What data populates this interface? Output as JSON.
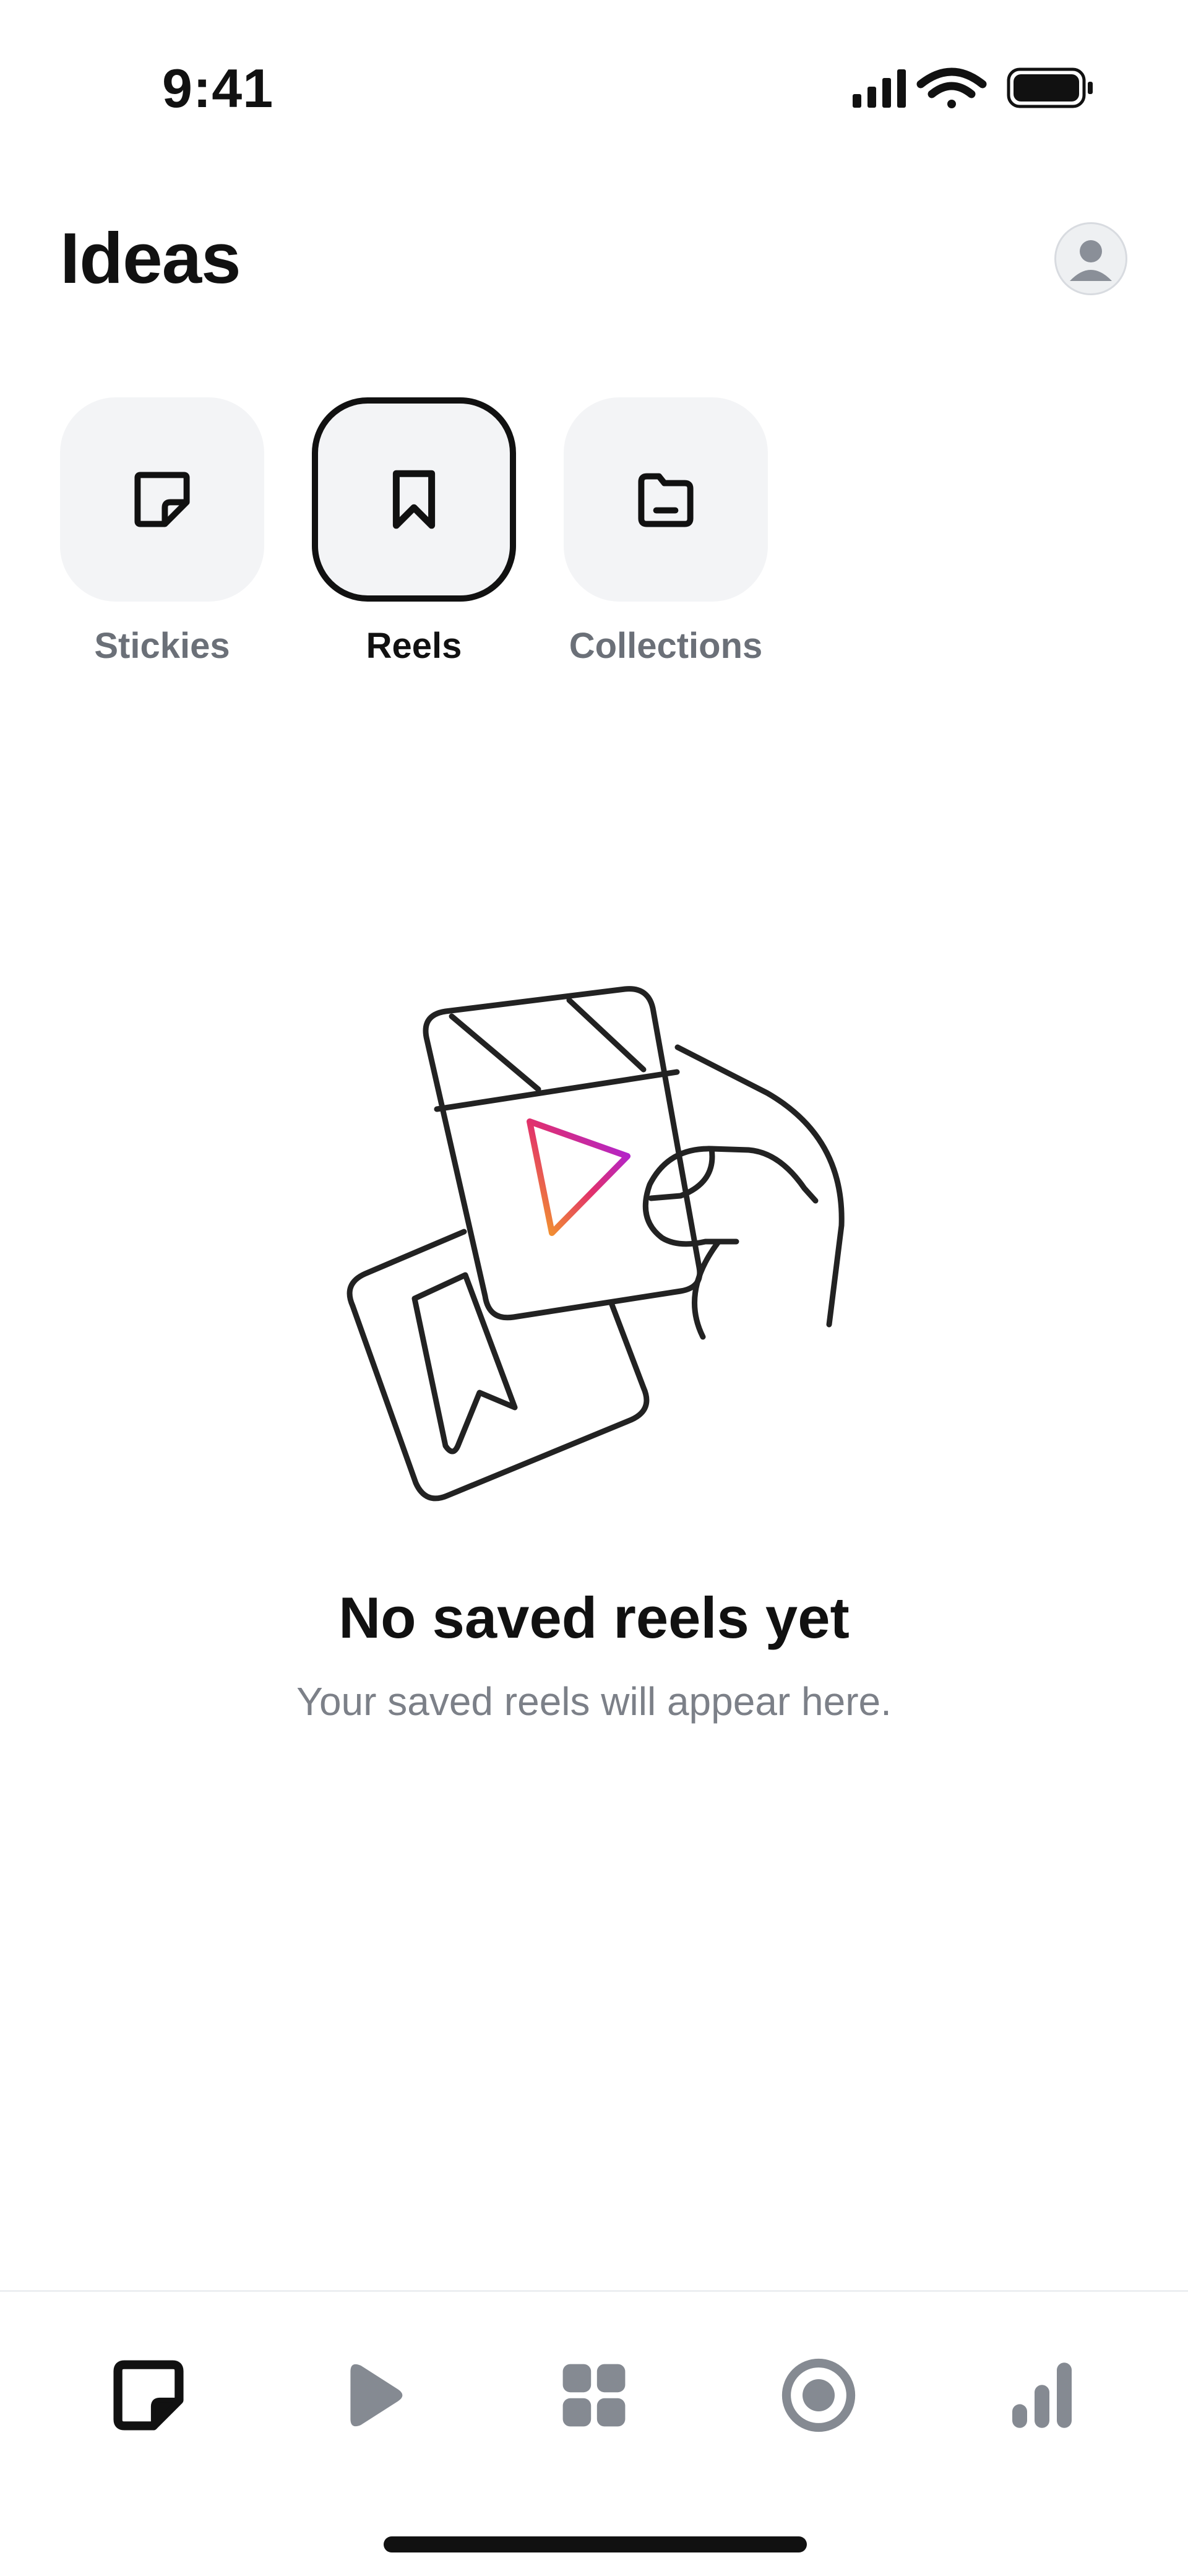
{
  "status_bar": {
    "time": "9:41"
  },
  "header": {
    "title": "Ideas"
  },
  "categories": [
    {
      "label": "Stickies",
      "icon": "sticky-note-icon",
      "selected": false
    },
    {
      "label": "Reels",
      "icon": "bookmark-icon",
      "selected": true
    },
    {
      "label": "Collections",
      "icon": "folder-icon",
      "selected": false
    }
  ],
  "empty_state": {
    "title": "No saved reels yet",
    "subtitle": "Your saved reels will appear here.",
    "illustration": "hand-holding-reel-illustration"
  },
  "bottom_nav": {
    "items": [
      {
        "icon": "sticky-note-icon",
        "active": true
      },
      {
        "icon": "play-icon",
        "active": false
      },
      {
        "icon": "grid-icon",
        "active": false
      },
      {
        "icon": "record-icon",
        "active": false
      },
      {
        "icon": "bar-chart-icon",
        "active": false
      }
    ]
  },
  "colors": {
    "text_primary": "#111111",
    "text_secondary": "#7c8088",
    "tile_background": "#f3f4f6",
    "nav_inactive": "#858a92",
    "play_gradient_start": "#f5a623",
    "play_gradient_mid": "#e1306c",
    "play_gradient_end": "#a020f0"
  }
}
